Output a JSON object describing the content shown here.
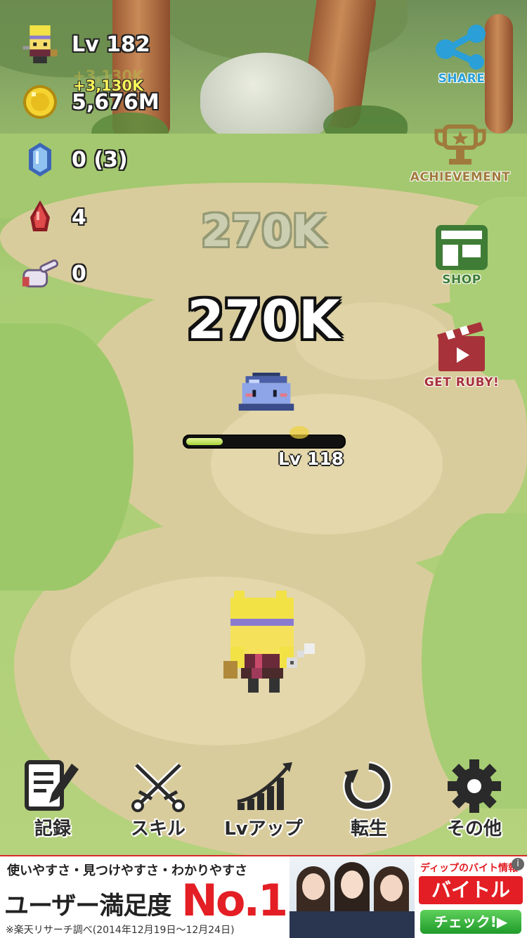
{
  "player": {
    "level": "Lv 182",
    "gold_gain": "+3,130K",
    "gold_gain_ghost": "+3,130K",
    "gold": "5,676M",
    "crystals": "0 (3)",
    "rubies": "4",
    "taps": "0"
  },
  "side_buttons": {
    "share": "SHARE",
    "achievement": "ACHIEVEMENT",
    "shop": "SHOP",
    "get_ruby": "GET RUBY!"
  },
  "damage": {
    "ghost": "270K",
    "main": "270K"
  },
  "enemy": {
    "level": "Lv 118",
    "hp_fraction": 0.24
  },
  "nav": {
    "record": "記録",
    "skill": "スキル",
    "levelup": "Lvアップ",
    "rebirth": "転生",
    "other": "その他"
  },
  "ad": {
    "tagline": "使いやすさ・見つけやすさ・わかりやすさ",
    "headline": "ユーザー満足度",
    "no1": "No.1",
    "note": "※楽天リサーチ調べ(2014年12月19日〜12月24日)",
    "right_top": "ディップのバイト情報",
    "brand": "バイトル",
    "cta": "チェック!▶",
    "info": "i"
  },
  "colors": {
    "share": "#2a9fd8",
    "achievement": "#a07a3c",
    "shop": "#3f7d36",
    "get_ruby": "#a8323a",
    "ad_red": "#e31e24"
  }
}
